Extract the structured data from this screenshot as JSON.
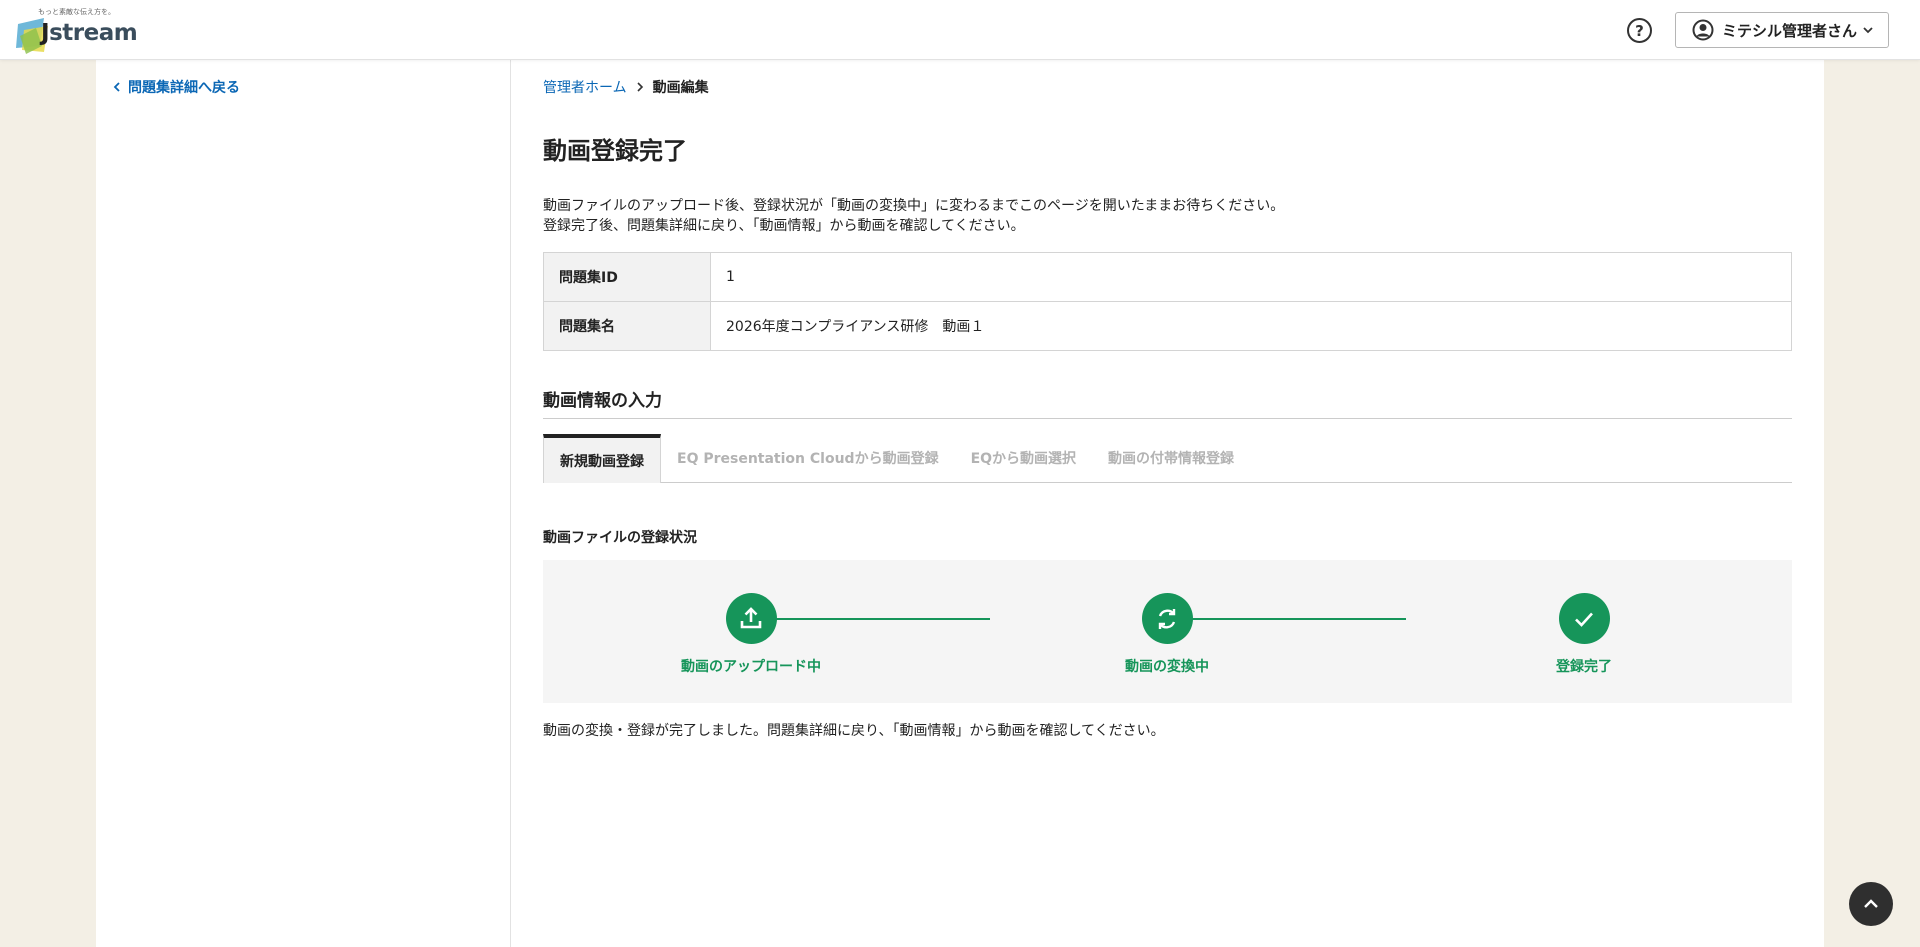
{
  "header": {
    "logo_tagline": "もっと素敵な伝え方を。",
    "logo_text": "stream",
    "logo_initial": "J",
    "help_icon": "question-circle-icon",
    "user_name": "ミテシル管理者さん"
  },
  "sidebar": {
    "back_link": "問題集詳細へ戻る"
  },
  "breadcrumb": {
    "home": "管理者ホーム",
    "current": "動画編集"
  },
  "page": {
    "title": "動画登録完了",
    "description_line1": "動画ファイルのアップロード後、登録状況が「動画の変換中」に変わるまでこのページを開いたままお待ちください。",
    "description_line2": "登録完了後、問題集詳細に戻り、「動画情報」から動画を確認してください。"
  },
  "info_table": [
    {
      "label": "問題集ID",
      "value": "1"
    },
    {
      "label": "問題集名",
      "value": "2026年度コンプライアンス研修　動画１"
    }
  ],
  "section": {
    "title": "動画情報の入力"
  },
  "tabs": [
    {
      "label": "新規動画登録",
      "active": true
    },
    {
      "label": "EQ Presentation Cloudから動画登録",
      "active": false
    },
    {
      "label": "EQから動画選択",
      "active": false
    },
    {
      "label": "動画の付帯情報登録",
      "active": false
    }
  ],
  "status": {
    "label": "動画ファイルの登録状況",
    "steps": [
      {
        "label": "動画のアップロード中",
        "icon": "upload-icon"
      },
      {
        "label": "動画の変換中",
        "icon": "refresh-icon"
      },
      {
        "label": "登録完了",
        "icon": "check-icon"
      }
    ],
    "complete_message": "動画の変換・登録が完了しました。問題集詳細に戻り、「動画情報」から動画を確認してください。"
  },
  "colors": {
    "accent_green": "#16955a",
    "link_blue": "#0b67b5",
    "page_bg": "#f3efe5"
  }
}
